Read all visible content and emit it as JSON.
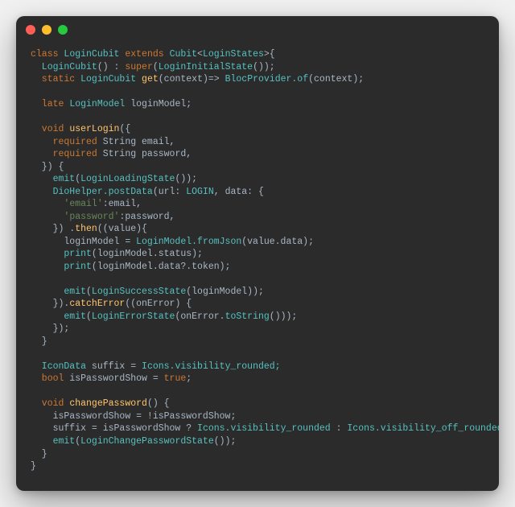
{
  "code": {
    "l01": {
      "a": "class ",
      "b": "LoginCubit ",
      "c": "extends ",
      "d": "Cubit",
      "e": "<",
      "f": "LoginStates",
      "g": ">{"
    },
    "l02": {
      "a": "  LoginCubit",
      "b": "() : ",
      "c": "super",
      "d": "(",
      "e": "LoginInitialState",
      "f": "());"
    },
    "l03": {
      "a": "  static ",
      "b": "LoginCubit ",
      "c": "get",
      "d": "(context)=> ",
      "e": "BlocProvider.of",
      "f": "(context);"
    },
    "l04": "",
    "l05": {
      "a": "  late ",
      "b": "LoginModel ",
      "c": "loginModel;"
    },
    "l06": "",
    "l07": {
      "a": "  void ",
      "b": "userLogin",
      "c": "({"
    },
    "l08": {
      "a": "    required ",
      "b": "String ",
      "c": "email,"
    },
    "l09": {
      "a": "    required ",
      "b": "String ",
      "c": "password,"
    },
    "l10": "  }) {",
    "l11": {
      "a": "    emit",
      "b": "(",
      "c": "LoginLoadingState",
      "d": "());"
    },
    "l12": {
      "a": "    DioHelper.postData",
      "b": "(url: ",
      "c": "LOGIN",
      "d": ", data: {"
    },
    "l13": {
      "a": "      ",
      "b": "'email'",
      "c": ":email,"
    },
    "l14": {
      "a": "      ",
      "b": "'password'",
      "c": ":password,"
    },
    "l15": {
      "a": "    }) .",
      "b": "then",
      "c": "((value){"
    },
    "l16": {
      "a": "      loginModel = ",
      "b": "LoginModel.fromJson",
      "c": "(value.data);"
    },
    "l17": {
      "a": "      print",
      "b": "(loginModel.status);"
    },
    "l18": {
      "a": "      print",
      "b": "(loginModel.data?.token);"
    },
    "l19": "",
    "l20": {
      "a": "      emit",
      "b": "(",
      "c": "LoginSuccessState",
      "d": "(loginModel));"
    },
    "l21": {
      "a": "    }).",
      "b": "catchError",
      "c": "((onError) {"
    },
    "l22": {
      "a": "      emit",
      "b": "(",
      "c": "LoginErrorState",
      "d": "(onError.",
      "e": "toString",
      "f": "()));"
    },
    "l23": "    });",
    "l24": "  }",
    "l25": "",
    "l26": {
      "a": "  IconData ",
      "b": "suffix = ",
      "c": "Icons.visibility_rounded;"
    },
    "l27": {
      "a": "  bool ",
      "b": "isPasswordShow = ",
      "c": "true",
      "d": ";"
    },
    "l28": "",
    "l29": {
      "a": "  void ",
      "b": "changePassword",
      "c": "() {"
    },
    "l30": {
      "a": "    isPasswordShow = !isPasswordShow;"
    },
    "l31": {
      "a": "    suffix = isPasswordShow ? ",
      "b": "Icons.visibility_rounded ",
      ": ": ": ",
      "c": "Icons.visibility_off_rounded;"
    },
    "l32": {
      "a": "    emit",
      "b": "(",
      "c": "LoginChangePasswordState",
      "d": "());"
    },
    "l33": "  }",
    "l34": "}"
  }
}
